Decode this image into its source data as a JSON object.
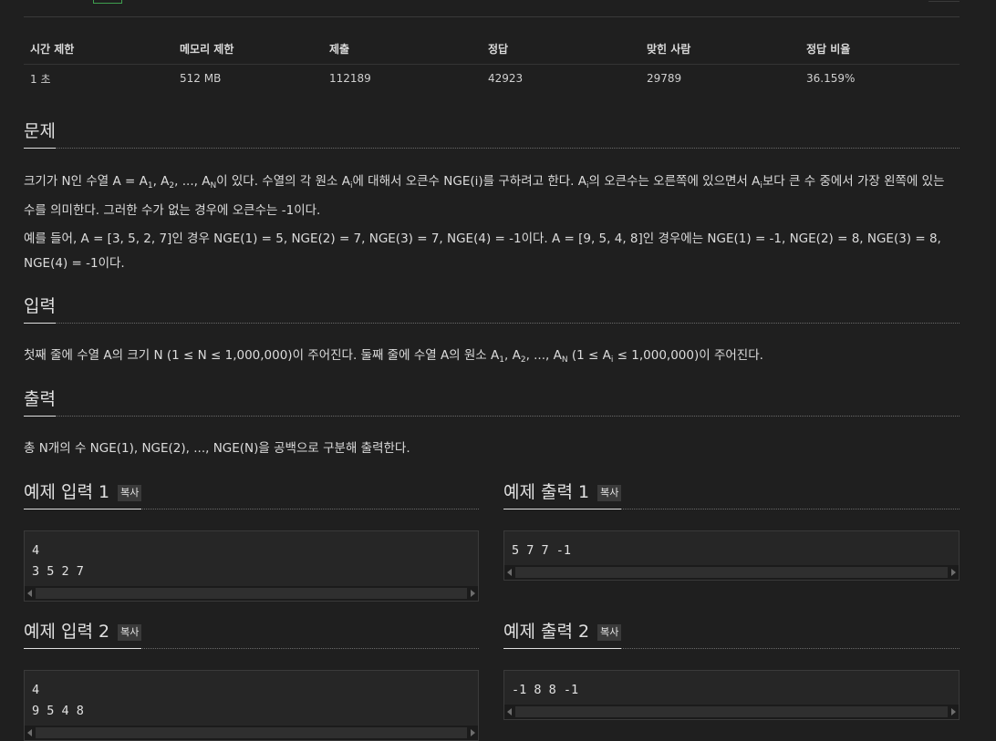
{
  "info_table": {
    "headers": [
      "시간 제한",
      "메모리 제한",
      "제출",
      "정답",
      "맞힌 사람",
      "정답 비율"
    ],
    "values": [
      "1 초",
      "512 MB",
      "112189",
      "42923",
      "29789",
      "36.159%"
    ]
  },
  "problem": {
    "title": "문제",
    "p1_a": "크기가 N인 수열 A = A",
    "p1_b": ", A",
    "p1_c": ", ..., A",
    "p1_d": "이 있다. 수열의 각 원소 A",
    "p1_e": "에 대해서 오큰수 NGE(i)를 구하려고 한다. A",
    "p1_f": "의 오큰수는 오른쪽에 있으면서 A",
    "p1_g": "보다 큰 수 중에서 가장 왼쪽에 있는 수를 의미한다. 그러한 수가 없는 경우에 오큰수는 -1이다.",
    "sub_1": "1",
    "sub_2": "2",
    "sub_N": "N",
    "sub_i": "i",
    "p2": "예를 들어, A = [3, 5, 2, 7]인 경우 NGE(1) = 5, NGE(2) = 7, NGE(3) = 7, NGE(4) = -1이다. A = [9, 5, 4, 8]인 경우에는 NGE(1) = -1, NGE(2) = 8, NGE(3) = 8, NGE(4) = -1이다."
  },
  "input": {
    "title": "입력",
    "t_a": "첫째 줄에 수열 A의 크기 N (1 ≤ N ≤ 1,000,000)이 주어진다. 둘째 줄에 수열 A의 원소 A",
    "t_b": ", A",
    "t_c": ", ..., A",
    "t_d": " (1 ≤ A",
    "t_e": " ≤ 1,000,000)이 주어진다."
  },
  "output": {
    "title": "출력",
    "text": "총 N개의 수 NGE(1), NGE(2), ..., NGE(N)을 공백으로 구분해 출력한다."
  },
  "examples": {
    "copy_label": "복사",
    "in1_title": "예제 입력 1",
    "in1_text": "4\n3 5 2 7",
    "out1_title": "예제 출력 1",
    "out1_text": "5 7 7 -1",
    "in2_title": "예제 입력 2",
    "in2_text": "4\n9 5 4 8",
    "out2_title": "예제 출력 2",
    "out2_text": "-1 8 8 -1"
  }
}
